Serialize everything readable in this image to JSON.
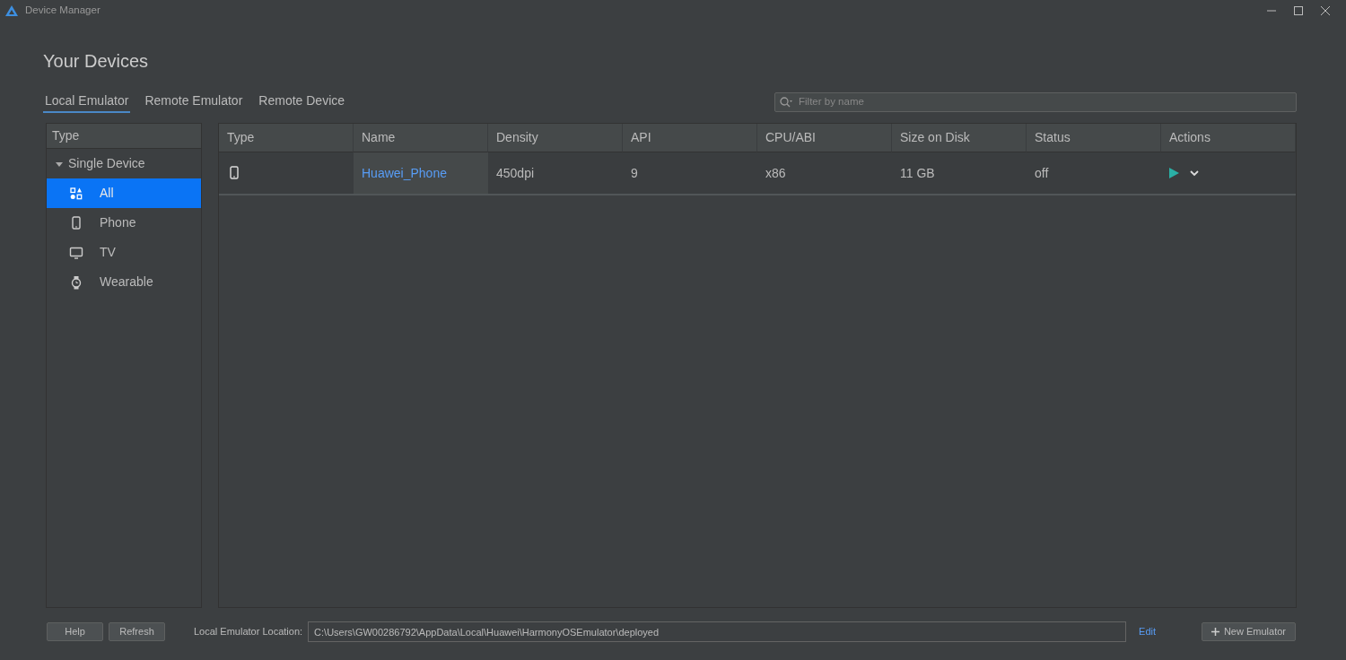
{
  "window": {
    "title": "Device Manager"
  },
  "heading": "Your Devices",
  "tabs": [
    {
      "label": "Local Emulator",
      "selected": true
    },
    {
      "label": "Remote Emulator",
      "selected": false
    },
    {
      "label": "Remote Device",
      "selected": false
    }
  ],
  "search": {
    "placeholder": "Filter by name"
  },
  "sidebar": {
    "header": "Type",
    "groups": [
      {
        "label": "Single Device",
        "expanded": true,
        "children": [
          {
            "label": "All",
            "kind": "all",
            "selected": true
          },
          {
            "label": "Phone",
            "kind": "phone",
            "selected": false
          },
          {
            "label": "TV",
            "kind": "tv",
            "selected": false
          },
          {
            "label": "Wearable",
            "kind": "watch",
            "selected": false
          }
        ]
      }
    ]
  },
  "table": {
    "columns": [
      "Type",
      "Name",
      "Density",
      "API",
      "CPU/ABI",
      "Size on Disk",
      "Status",
      "Actions"
    ],
    "rows": [
      {
        "kind": "phone",
        "name": "Huawei_Phone",
        "density": "450dpi",
        "api": "9",
        "cpu": "x86",
        "size": "11 GB",
        "status": "off"
      }
    ]
  },
  "footer": {
    "buttons": [
      "Help",
      "Refresh"
    ],
    "location_label": "Local Emulator Location:",
    "location_value": "C:\\Users\\GW00286792\\AppData\\Local\\Huawei\\HarmonyOSEmulator\\deployed",
    "edit_link": "Edit",
    "new_button": "New Emulator"
  }
}
